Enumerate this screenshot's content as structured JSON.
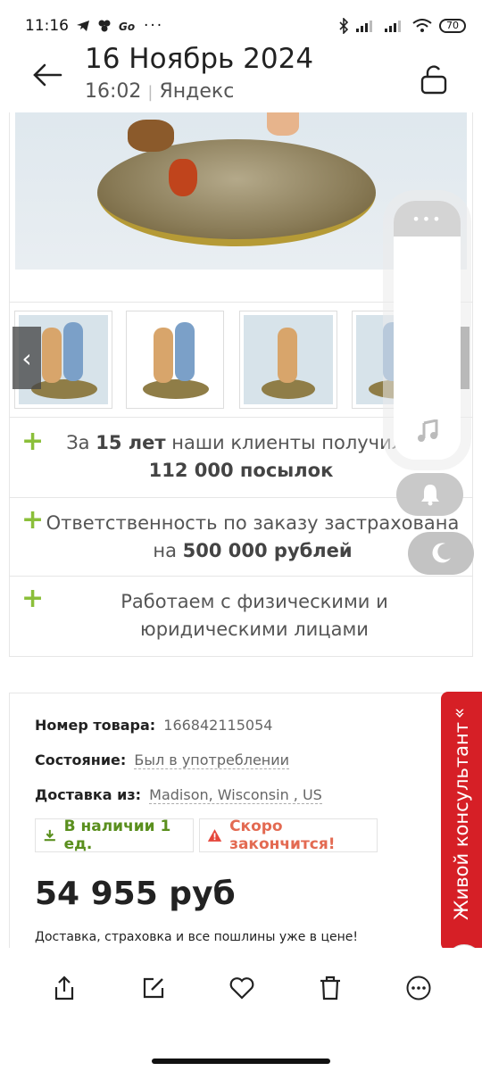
{
  "status_bar": {
    "time": "11:16",
    "battery": "70"
  },
  "header": {
    "date": "16 Ноябрь 2024",
    "time": "16:02",
    "source": "Яндекс"
  },
  "benefits": [
    {
      "prefix": "За ",
      "bold": "15 лет",
      "middle": " наши клиенты получили ",
      "bold2": "112 000 посылок"
    },
    {
      "prefix": "Ответственность по заказу застрахована на ",
      "bold": "500 000 рублей"
    },
    {
      "text": "Работаем с физическими и юридическими лицами"
    }
  ],
  "product": {
    "id_label": "Номер товара:",
    "id_value": "166842115054",
    "condition_label": "Состояние:",
    "condition_value": "Был в употреблении",
    "ship_label": "Доставка из:",
    "ship_value": "Madison, Wisconsin , US",
    "in_stock": "В наличии 1 ед.",
    "low_stock": "Скоро закончится!",
    "price": "54 955 руб",
    "delivery_note": "Доставка, страховка и все пошлины уже в цене!"
  },
  "consultant": {
    "label": "Живой консультант",
    "chevron": "«"
  },
  "icons": {
    "status": [
      "telegram-icon",
      "bluetooth-icon",
      "signal-icon",
      "wifi-icon"
    ],
    "bottom": [
      "share-icon",
      "edit-icon",
      "heart-icon",
      "trash-icon",
      "more-icon"
    ]
  },
  "colors": {
    "accent_green": "#8bbf3a",
    "in_stock_green": "#5a8f1e",
    "warning_red": "#e36a52",
    "consultant_red": "#d61f26"
  }
}
